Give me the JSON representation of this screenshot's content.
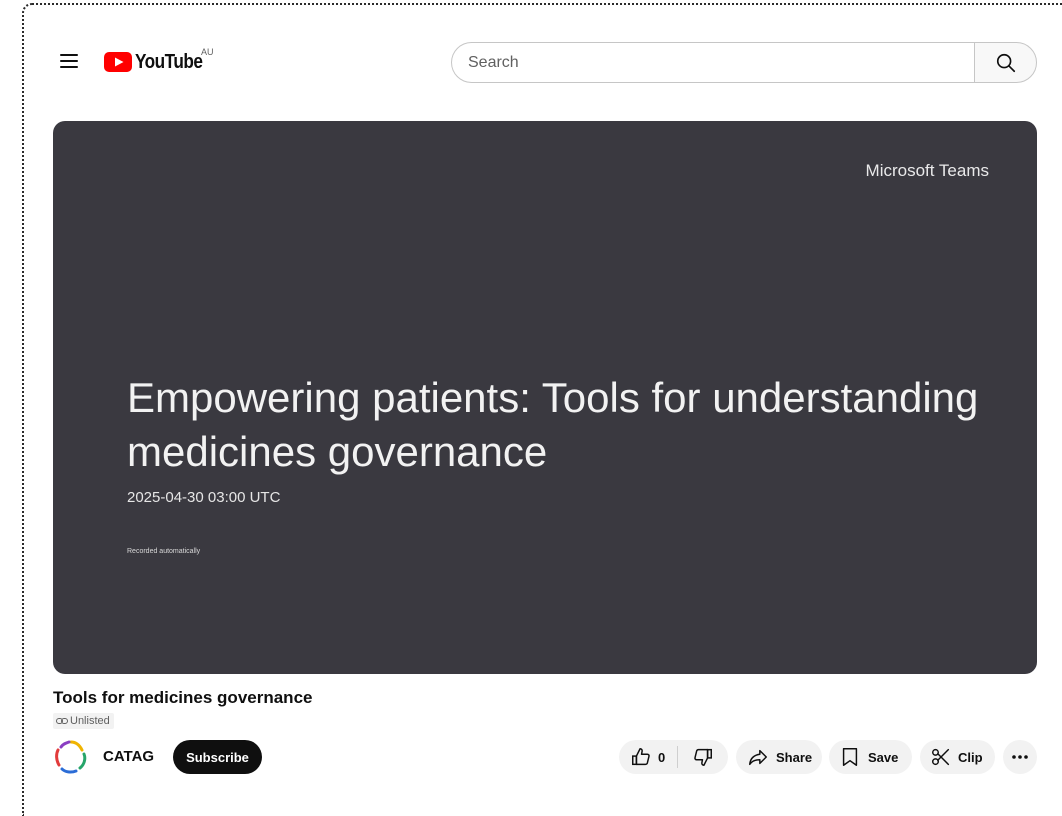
{
  "header": {
    "brand": "YouTube",
    "region": "AU",
    "search_placeholder": "Search",
    "icons": [
      "menu-icon",
      "youtube-logo-icon",
      "search-icon"
    ]
  },
  "video": {
    "brand_tag": "Microsoft Teams",
    "slide_title": "Empowering patients: Tools for understanding medicines governance",
    "slide_date": "2025-04-30 03:00 UTC",
    "slide_note": "Recorded automatically",
    "background_color": "#3a3940"
  },
  "meta": {
    "title": "Tools for medicines governance",
    "visibility": "Unlisted"
  },
  "channel": {
    "name": "CATAG",
    "subscribe_label": "Subscribe"
  },
  "actions": {
    "like_count": "0",
    "share_label": "Share",
    "save_label": "Save",
    "clip_label": "Clip"
  },
  "colors": {
    "brand_red": "#ff0000",
    "subscribe_bg": "#0f0f0f",
    "pill_bg": "#f2f2f2"
  }
}
